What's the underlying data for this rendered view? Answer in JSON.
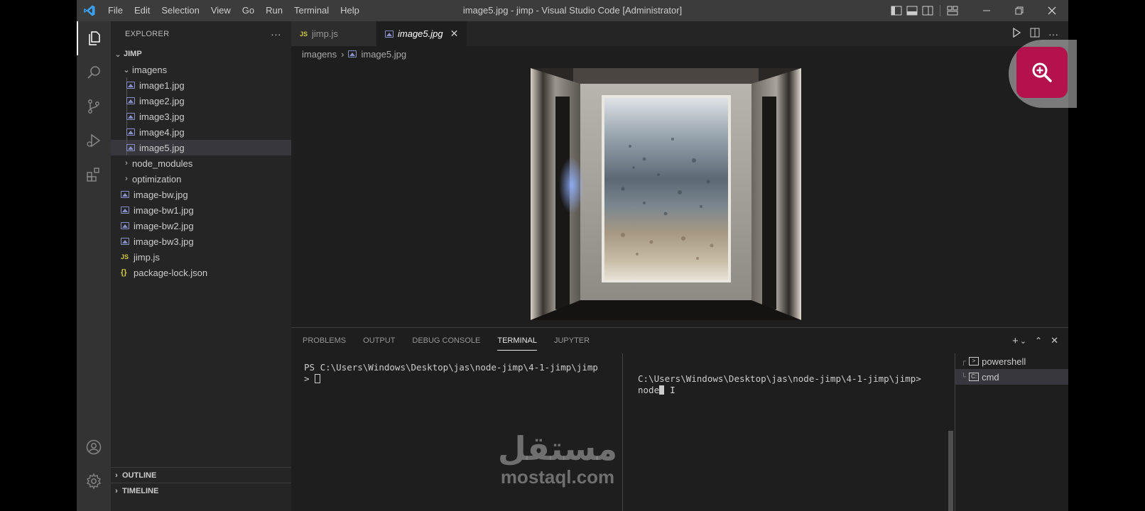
{
  "window": {
    "title": "image5.jpg - jimp - Visual Studio Code [Administrator]",
    "menu": [
      "File",
      "Edit",
      "Selection",
      "View",
      "Go",
      "Run",
      "Terminal",
      "Help"
    ]
  },
  "sidebar": {
    "header": "EXPLORER",
    "more_label": "···",
    "root": "JIMP",
    "folder": "imagens",
    "folder_files": [
      "image1.jpg",
      "image2.jpg",
      "image3.jpg",
      "image4.jpg",
      "image5.jpg"
    ],
    "selected_file": "image5.jpg",
    "collapsed_folders": [
      "node_modules",
      "optimization"
    ],
    "root_files": [
      {
        "name": "image-bw.jpg",
        "icon": "image-icon"
      },
      {
        "name": "image-bw1.jpg",
        "icon": "image-icon"
      },
      {
        "name": "image-bw2.jpg",
        "icon": "image-icon"
      },
      {
        "name": "image-bw3.jpg",
        "icon": "image-icon"
      },
      {
        "name": "jimp.js",
        "icon": "js-icon"
      },
      {
        "name": "package-lock.json",
        "icon": "json-icon"
      }
    ],
    "outline": "OUTLINE",
    "timeline": "TIMELINE"
  },
  "editor": {
    "tabs": [
      {
        "label": "jimp.js",
        "icon": "js-icon",
        "active": false
      },
      {
        "label": "image5.jpg",
        "icon": "image-icon",
        "active": true
      }
    ],
    "breadcrumb": [
      "imagens",
      "image5.jpg"
    ]
  },
  "panel": {
    "tabs": [
      "PROBLEMS",
      "OUTPUT",
      "DEBUG CONSOLE",
      "TERMINAL",
      "JUPYTER"
    ],
    "active_tab": "TERMINAL",
    "terminal_left": {
      "line1": "PS C:\\Users\\Windows\\Desktop\\jas\\node-jimp\\4-1-jimp\\jimp",
      "line2": "> "
    },
    "terminal_right": {
      "line1": "C:\\Users\\Windows\\Desktop\\jas\\node-jimp\\4-1-jimp\\jimp>",
      "line2": "node"
    },
    "terminal_list": [
      "powershell",
      "cmd"
    ]
  },
  "watermark": {
    "arabic": "مستقل",
    "latin": "mostaql.com"
  },
  "colors": {
    "accent_zoom": "#b3124d",
    "titlebar": "#3c3c3c",
    "sidebar": "#252526",
    "editor": "#1e1e1e",
    "selection": "#37373d"
  }
}
